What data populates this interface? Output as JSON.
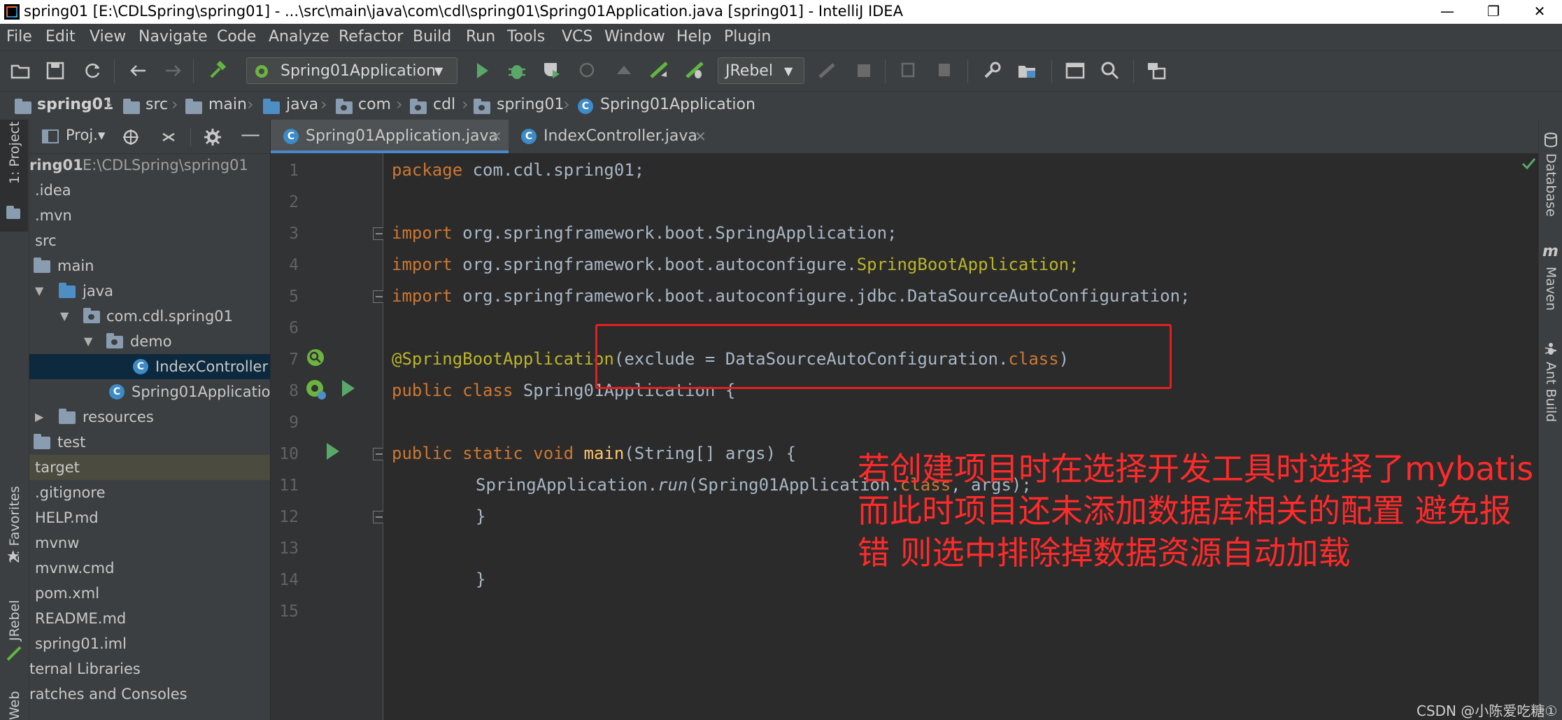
{
  "window": {
    "title": "spring01 [E:\\CDLSpring\\spring01] - ...\\src\\main\\java\\com\\cdl\\spring01\\Spring01Application.java [spring01] - IntelliJ IDEA",
    "minimize": "—",
    "restore": "❐",
    "close": "✕"
  },
  "menu": [
    "File",
    "Edit",
    "View",
    "Navigate",
    "Code",
    "Analyze",
    "Refactor",
    "Build",
    "Run",
    "Tools",
    "VCS",
    "Window",
    "Help",
    "Plugin"
  ],
  "toolbar": {
    "run_config": "Spring01Application",
    "jrebel": "JRebel"
  },
  "breadcrumb": [
    "spring01",
    "src",
    "main",
    "java",
    "com",
    "cdl",
    "spring01",
    "Spring01Application"
  ],
  "left_stripe": {
    "project": "1: Project",
    "favorites": "2: Favorites",
    "jrebel": "JRebel",
    "web": "Web"
  },
  "project_panel": {
    "header_label": "Proj.▾",
    "tree": [
      {
        "label": "ring01",
        "extra": "E:\\CDLSpring\\spring01"
      },
      {
        "label": ".idea"
      },
      {
        "label": ".mvn"
      },
      {
        "label": "src"
      },
      {
        "label": "main"
      },
      {
        "label": "java"
      },
      {
        "label": "com.cdl.spring01"
      },
      {
        "label": "demo"
      },
      {
        "label": "IndexController"
      },
      {
        "label": "Spring01Application"
      },
      {
        "label": "resources"
      },
      {
        "label": "test"
      },
      {
        "label": "target"
      },
      {
        "label": ".gitignore"
      },
      {
        "label": "HELP.md"
      },
      {
        "label": "mvnw"
      },
      {
        "label": "mvnw.cmd"
      },
      {
        "label": "pom.xml"
      },
      {
        "label": "README.md"
      },
      {
        "label": "spring01.iml"
      },
      {
        "label": "ternal Libraries"
      },
      {
        "label": "ratches and Consoles"
      }
    ]
  },
  "tabs": [
    {
      "label": "Spring01Application.java",
      "active": true
    },
    {
      "label": "IndexController.java",
      "active": false
    }
  ],
  "line_numbers": [
    "1",
    "2",
    "3",
    "4",
    "5",
    "6",
    "7",
    "8",
    "9",
    "10",
    "11",
    "12",
    "13",
    "14",
    "15"
  ],
  "code": {
    "l1_kw": "package ",
    "l1_rest": "com.cdl.spring01;",
    "l3_kw": "import ",
    "l3_rest": "org.springframework.boot.SpringApplication;",
    "l4_kw": "import ",
    "l4_pkg": "org.springframework.boot.autoconfigure.",
    "l4_cls": "SpringBootApplication;",
    "l5_kw": "import ",
    "l5_rest": "org.springframework.boot.autoconfigure.jdbc.DataSourceAutoConfiguration;",
    "l7_ann": "@SpringBootApplication",
    "l7_rest": "(exclude = DataSourceAutoConfiguration.",
    "l7_kw": "class",
    "l7_end": ")",
    "l8_kw": "public class ",
    "l8_rest": "Spring01Application {",
    "l10_kw": "public static void ",
    "l10_method": "main",
    "l10_rest": "(String[] args) {",
    "l11_a": "SpringApplication.",
    "l11_run": "run",
    "l11_b": "(Spring01Application.",
    "l11_kw": "class",
    "l11_c": ", args);",
    "l12": "}",
    "l14": "}"
  },
  "right_stripe": {
    "database": "Database",
    "maven": "Maven",
    "ant": "Ant Build"
  },
  "annotation": {
    "line1": "若创建项目时在选择开发工具时选择了mybatis",
    "line2": "而此时项目还未添加数据库相关的配置 避免报",
    "line3": "错 则选中排除掉数据资源自动加载",
    "color": "#ff2a2a"
  },
  "watermark": "CSDN @小陈爱吃糖①"
}
